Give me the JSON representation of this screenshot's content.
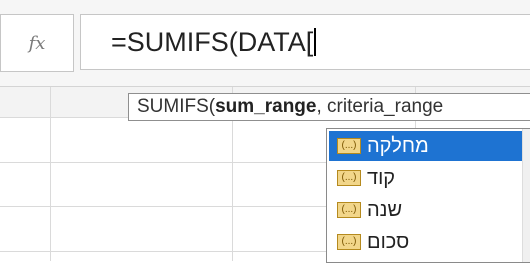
{
  "formula_bar": {
    "fx_label": "fx",
    "formula_text": "=SUMIFS(DATA["
  },
  "tooltip": {
    "prefix": "SUMIFS(",
    "current_arg": "sum_range",
    "rest": ", criteria_range"
  },
  "autocomplete": {
    "items": [
      {
        "label": "מחלקה",
        "icon": "table-column-icon",
        "selected": true
      },
      {
        "label": "קוד",
        "icon": "table-column-icon",
        "selected": false
      },
      {
        "label": "שנה",
        "icon": "table-column-icon",
        "selected": false
      },
      {
        "label": "סכום",
        "icon": "table-column-icon",
        "selected": false
      }
    ],
    "icon_glyph": "(...)"
  },
  "colors": {
    "selection": "#1e73d2",
    "column_icon": "#f2d68a"
  }
}
